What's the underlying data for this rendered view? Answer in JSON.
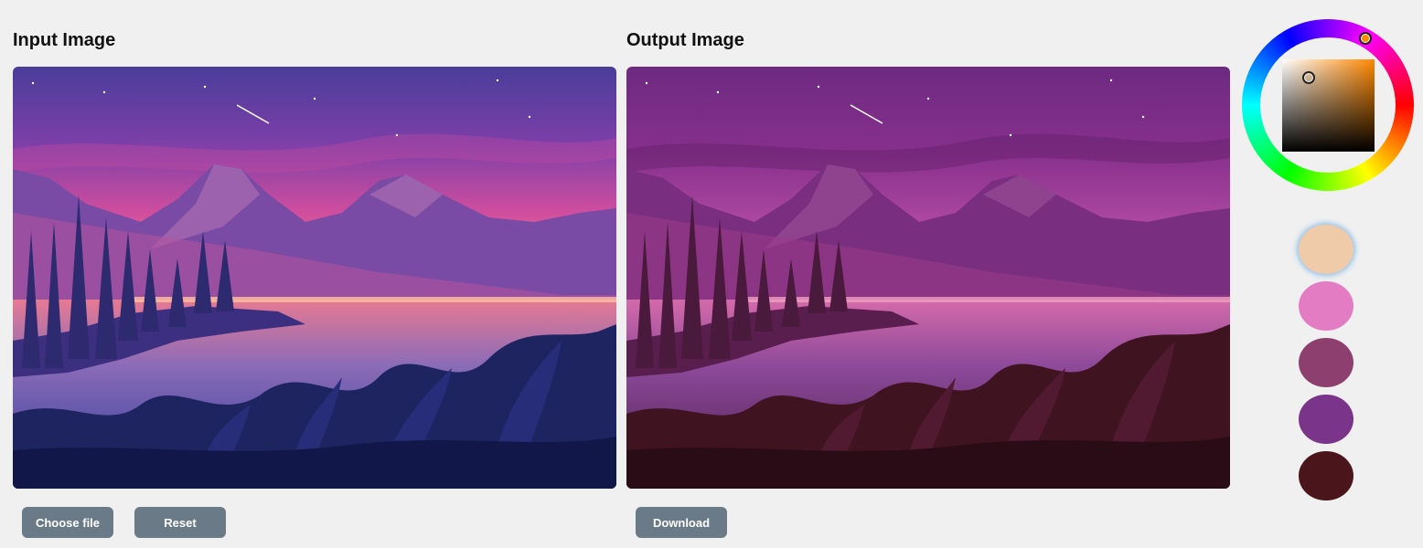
{
  "input_panel": {
    "title": "Input Image",
    "choose_label": "Choose file",
    "reset_label": "Reset"
  },
  "output_panel": {
    "title": "Output Image",
    "download_label": "Download"
  },
  "color_picker": {
    "current_color": "#f0a050",
    "hue_color": "#ff8800"
  },
  "palette": [
    {
      "color": "#efcba9",
      "selected": true
    },
    {
      "color": "#e47cc4",
      "selected": false
    },
    {
      "color": "#8d4070",
      "selected": false
    },
    {
      "color": "#7a358a",
      "selected": false
    },
    {
      "color": "#4a161c",
      "selected": false
    }
  ]
}
